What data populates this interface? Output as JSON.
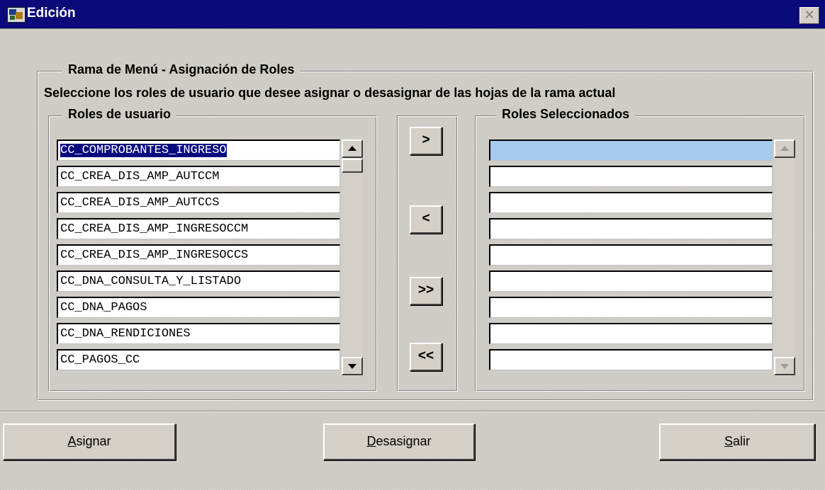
{
  "window": {
    "title": "Edición",
    "icon": "app-icon",
    "close_glyph": "✕"
  },
  "group": {
    "legend": "Rama de Menú - Asignación de Roles",
    "instruction": "Seleccione los roles de usuario que desee asignar o desasignar de las hojas de la rama actual"
  },
  "user_roles": {
    "legend": "Roles de usuario",
    "items": [
      "CC_COMPROBANTES_INGRESO",
      "CC_CREA_DIS_AMP_AUTCCM",
      "CC_CREA_DIS_AMP_AUTCCS",
      "CC_CREA_DIS_AMP_INGRESOCCM",
      "CC_CREA_DIS_AMP_INGRESOCCS",
      "CC_DNA_CONSULTA_Y_LISTADO",
      "CC_DNA_PAGOS",
      "CC_DNA_RENDICIONES",
      "CC_PAGOS_CC"
    ],
    "selected_index": 0
  },
  "selected_roles": {
    "legend": "Roles Seleccionados",
    "items": [
      "",
      "",
      "",
      "",
      "",
      "",
      "",
      "",
      ""
    ]
  },
  "move_buttons": {
    "add_one": ">",
    "remove_one": "<",
    "add_all": ">>",
    "remove_all": "<<"
  },
  "footer": {
    "assign": {
      "mnemonic": "A",
      "rest": "signar"
    },
    "unassign": {
      "mnemonic": "D",
      "rest": "esasignar"
    },
    "exit": {
      "mnemonic": "S",
      "rest": "alir"
    }
  }
}
